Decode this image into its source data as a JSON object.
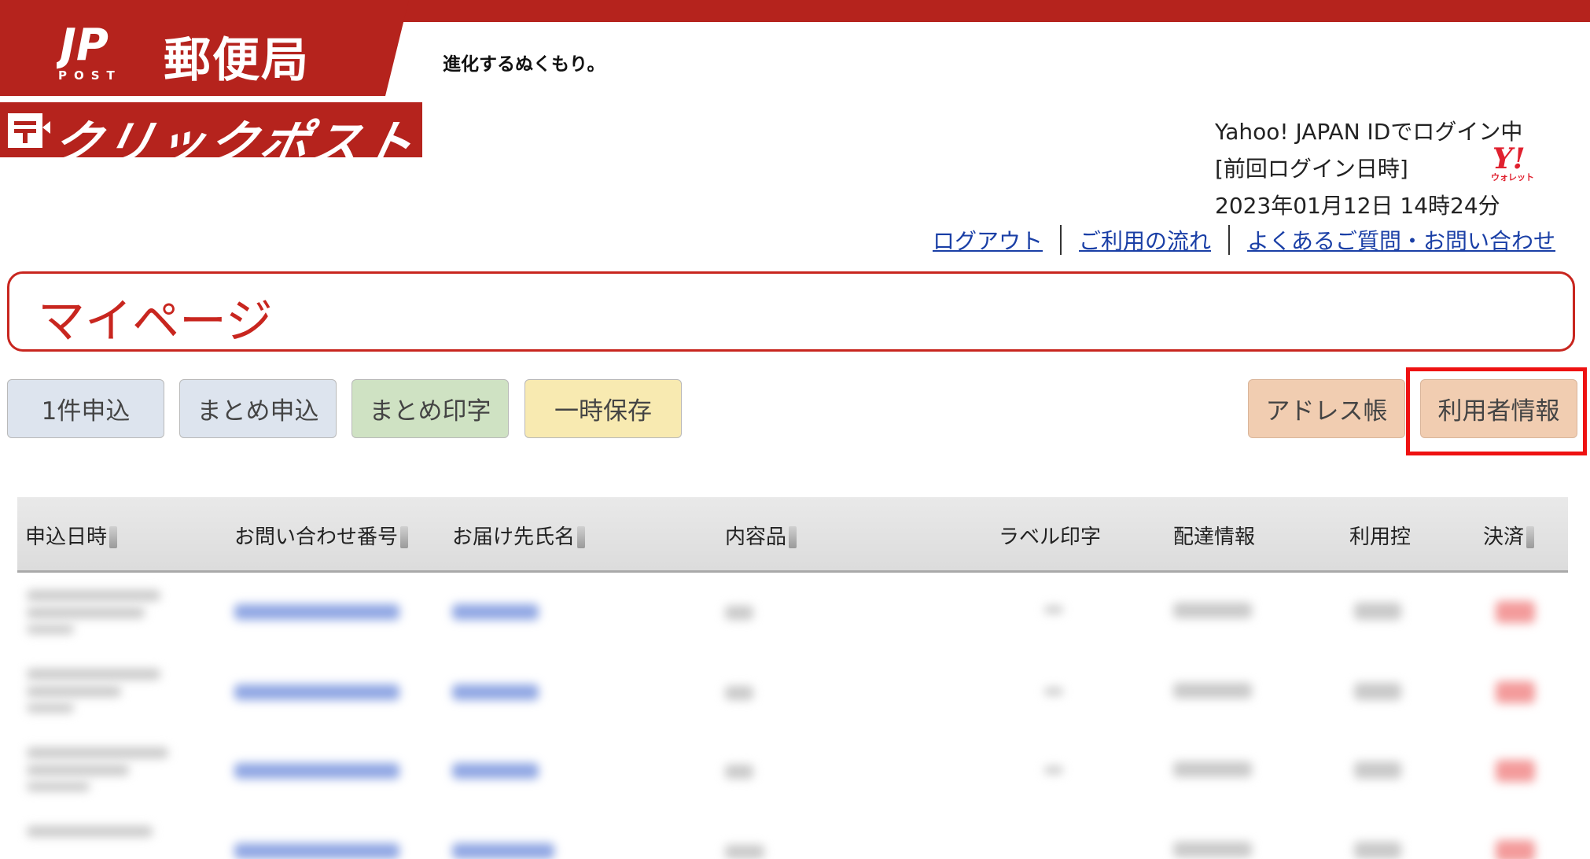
{
  "header": {
    "logo_text": "JP POST",
    "brand": "郵便局",
    "tagline": "進化するぬくもり。",
    "service_name": "クリックポスト"
  },
  "login": {
    "line1": "Yahoo! JAPAN IDでログイン中",
    "line2": "[前回ログイン日時]",
    "line3": "2023年01月12日 14時24分",
    "wallet_logo_text": "Y! ウォレット"
  },
  "links": [
    {
      "label": "ログアウト"
    },
    {
      "label": "ご利用の流れ"
    },
    {
      "label": "よくあるご質問・お問い合わせ"
    }
  ],
  "page_title": "マイページ",
  "buttons": {
    "single": "1件申込",
    "bulk": "まとめ申込",
    "bulk_print": "まとめ印字",
    "temp_save": "一時保存",
    "address_book": "アドレス帳",
    "user_info": "利用者情報"
  },
  "table": {
    "columns": [
      "申込日時",
      "お問い合わせ番号",
      "お届け先氏名",
      "内容品",
      "ラベル印字",
      "配達情報",
      "利用控",
      "決済"
    ],
    "row_count_visible": 4
  },
  "colors": {
    "brand_red": "#b5231d",
    "link_blue": "#1a3fa6",
    "highlight": "#ee1111"
  }
}
